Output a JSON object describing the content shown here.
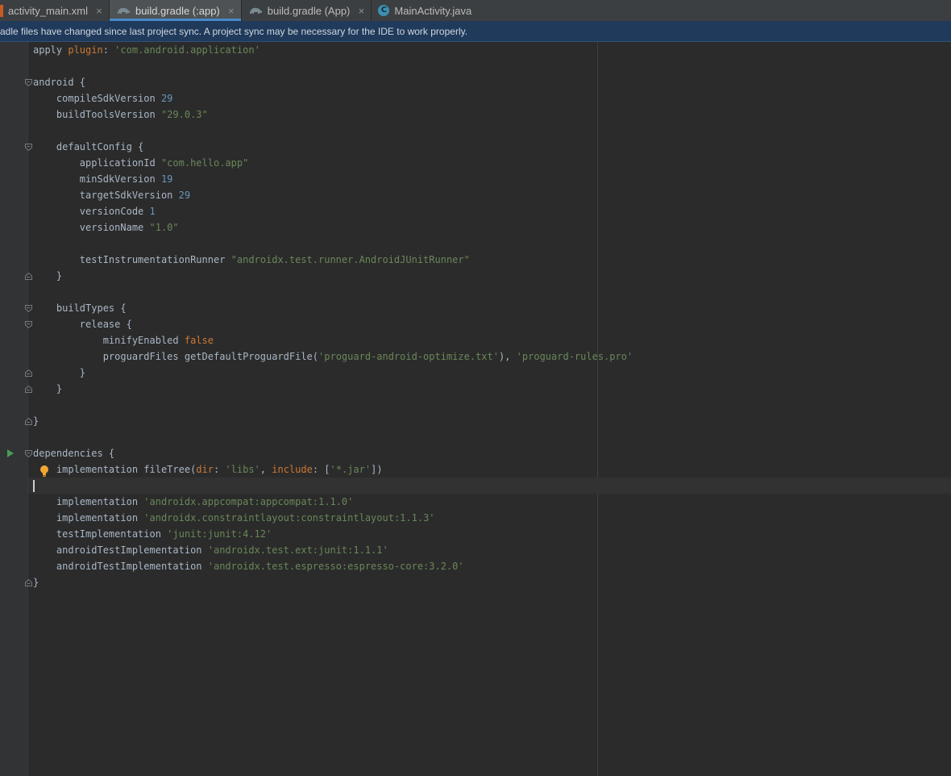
{
  "tabs": [
    {
      "label": "activity_main.xml",
      "icon": "xml-file-icon"
    },
    {
      "label": "build.gradle (:app)",
      "icon": "gradle-icon"
    },
    {
      "label": "build.gradle (App)",
      "icon": "gradle-icon"
    },
    {
      "label": "MainActivity.java",
      "icon": "java-class-icon"
    }
  ],
  "active_tab": "build.gradle (:app)",
  "tab_close_glyph": "×",
  "java_icon_letter": "C",
  "notification": {
    "text": "radle files have changed since last project sync. A project sync may be necessary for the IDE to work properly."
  },
  "code_lines": [
    [
      {
        "t": "apply ",
        "c": "plain"
      },
      {
        "t": "plugin",
        "c": "cfg"
      },
      {
        "t": ": ",
        "c": "plain"
      },
      {
        "t": "'com.android.application'",
        "c": "str"
      }
    ],
    [],
    [
      {
        "t": "android {",
        "c": "plain"
      }
    ],
    [
      {
        "t": "    compileSdkVersion ",
        "c": "plain"
      },
      {
        "t": "29",
        "c": "num"
      }
    ],
    [
      {
        "t": "    buildToolsVersion ",
        "c": "plain"
      },
      {
        "t": "\"29.0.3\"",
        "c": "str"
      }
    ],
    [],
    [
      {
        "t": "    defaultConfig {",
        "c": "plain"
      }
    ],
    [
      {
        "t": "        applicationId ",
        "c": "plain"
      },
      {
        "t": "\"com.hello.app\"",
        "c": "str"
      }
    ],
    [
      {
        "t": "        minSdkVersion ",
        "c": "plain"
      },
      {
        "t": "19",
        "c": "num"
      }
    ],
    [
      {
        "t": "        targetSdkVersion ",
        "c": "plain"
      },
      {
        "t": "29",
        "c": "num"
      }
    ],
    [
      {
        "t": "        versionCode ",
        "c": "plain"
      },
      {
        "t": "1",
        "c": "num"
      }
    ],
    [
      {
        "t": "        versionName ",
        "c": "plain"
      },
      {
        "t": "\"1.0\"",
        "c": "str"
      }
    ],
    [],
    [
      {
        "t": "        testInstrumentationRunner ",
        "c": "plain"
      },
      {
        "t": "\"androidx.test.runner.AndroidJUnitRunner\"",
        "c": "str"
      }
    ],
    [
      {
        "t": "    }",
        "c": "plain"
      }
    ],
    [],
    [
      {
        "t": "    buildTypes {",
        "c": "plain"
      }
    ],
    [
      {
        "t": "        release {",
        "c": "plain"
      }
    ],
    [
      {
        "t": "            minifyEnabled ",
        "c": "plain"
      },
      {
        "t": "false",
        "c": "kw"
      }
    ],
    [
      {
        "t": "            proguardFiles getDefaultProguardFile(",
        "c": "plain"
      },
      {
        "t": "'proguard-android-optimize.txt'",
        "c": "str"
      },
      {
        "t": "), ",
        "c": "plain"
      },
      {
        "t": "'proguard-rules.pro'",
        "c": "str"
      }
    ],
    [
      {
        "t": "        }",
        "c": "plain"
      }
    ],
    [
      {
        "t": "    }",
        "c": "plain"
      }
    ],
    [],
    [
      {
        "t": "}",
        "c": "plain"
      }
    ],
    [],
    [
      {
        "t": "dependencies {",
        "c": "plain"
      }
    ],
    [
      {
        "t": "    implementation fileTree(",
        "c": "plain"
      },
      {
        "t": "dir",
        "c": "cfg"
      },
      {
        "t": ": ",
        "c": "plain"
      },
      {
        "t": "'libs'",
        "c": "str"
      },
      {
        "t": ", ",
        "c": "plain"
      },
      {
        "t": "include",
        "c": "cfg"
      },
      {
        "t": ": [",
        "c": "plain"
      },
      {
        "t": "'*.jar'",
        "c": "str"
      },
      {
        "t": "])",
        "c": "plain"
      }
    ],
    [],
    [
      {
        "t": "    implementation ",
        "c": "plain"
      },
      {
        "t": "'androidx.appcompat:appcompat:1.1.0'",
        "c": "str"
      }
    ],
    [
      {
        "t": "    implementation ",
        "c": "plain"
      },
      {
        "t": "'androidx.constraintlayout:constraintlayout:1.1.3'",
        "c": "str"
      }
    ],
    [
      {
        "t": "    testImplementation ",
        "c": "plain"
      },
      {
        "t": "'junit:junit:4.12'",
        "c": "str"
      }
    ],
    [
      {
        "t": "    androidTestImplementation ",
        "c": "plain"
      },
      {
        "t": "'androidx.test.ext:junit:1.1.1'",
        "c": "str"
      }
    ],
    [
      {
        "t": "    androidTestImplementation ",
        "c": "plain"
      },
      {
        "t": "'androidx.test.espresso:espresso-core:3.2.0'",
        "c": "str"
      }
    ],
    [
      {
        "t": "}",
        "c": "plain"
      }
    ]
  ],
  "fold_markers": [
    {
      "line": 2,
      "kind": "open"
    },
    {
      "line": 6,
      "kind": "open"
    },
    {
      "line": 14,
      "kind": "close"
    },
    {
      "line": 16,
      "kind": "open"
    },
    {
      "line": 17,
      "kind": "open"
    },
    {
      "line": 20,
      "kind": "close"
    },
    {
      "line": 21,
      "kind": "close"
    },
    {
      "line": 23,
      "kind": "close"
    },
    {
      "line": 25,
      "kind": "open"
    },
    {
      "line": 33,
      "kind": "close"
    }
  ],
  "colors": {
    "editor_bg": "#2b2b2b",
    "keyword": "#cc7832",
    "number": "#6897bb",
    "string": "#6a8759",
    "text": "#a9b7c6",
    "notification_bg": "#203a5c",
    "active_tab_underline": "#4a88c7"
  }
}
